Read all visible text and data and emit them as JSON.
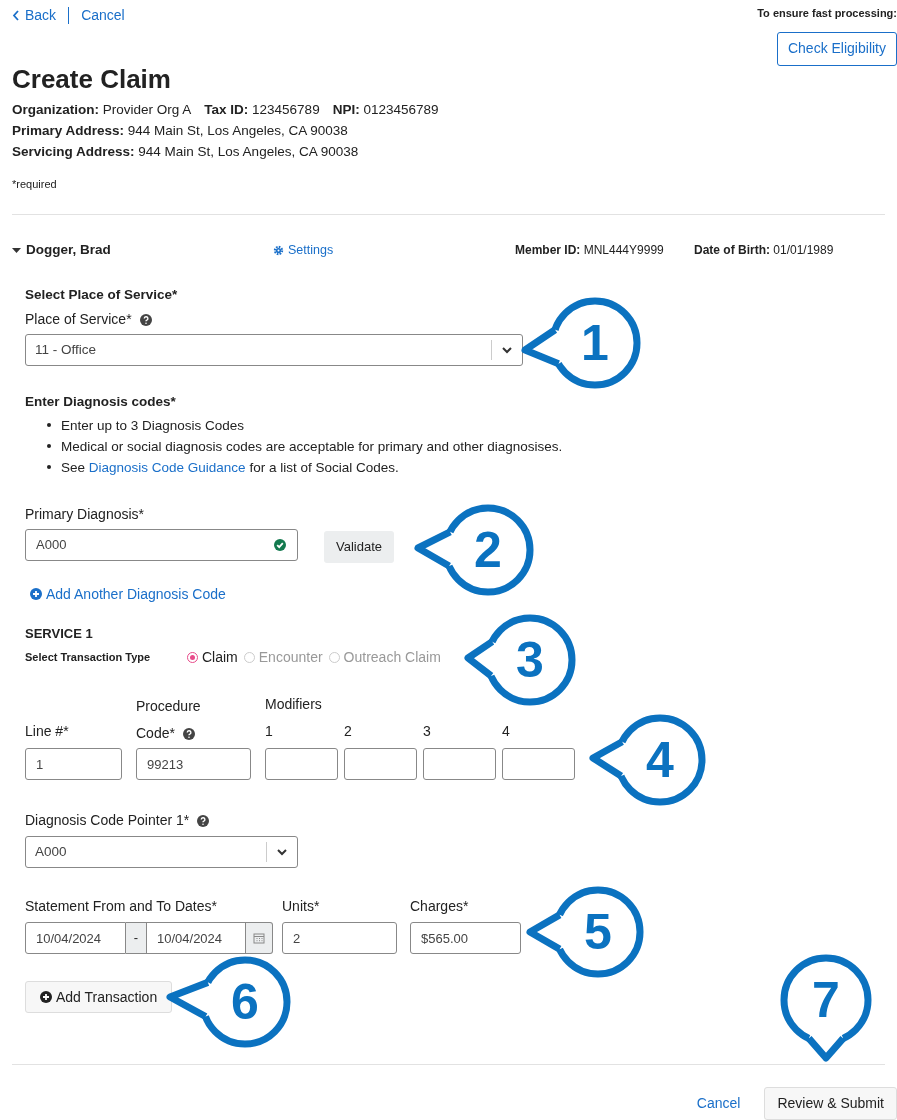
{
  "nav": {
    "back": "Back",
    "cancel": "Cancel"
  },
  "eligibility": {
    "hint": "To ensure fast processing:",
    "button": "Check Eligibility"
  },
  "title": "Create Claim",
  "provider_info": [
    [
      "**Organization:** Provider Org A",
      "**Tax ID:** 123456789",
      "**NPI:** 0123456789"
    ],
    [
      "**Primary Address:** 944 Main St, Los Angeles, CA 90038"
    ],
    [
      "**Servicing Address:** 944 Main St, Los Angeles, CA 90038"
    ]
  ],
  "required_note": "*required",
  "patient": {
    "name": "Dogger, Brad",
    "expanded": true,
    "settings": "Settings",
    "member_id": "**Member ID:** MNL444Y9999",
    "dob": "**Date of Birth:** 01/01/1989"
  },
  "place_of_service": {
    "heading": "Select Place of Service*",
    "label": "Place of Service*",
    "value": "11 - Office"
  },
  "diagnosis_intro": {
    "heading": "Enter Diagnosis codes*",
    "bullets": [
      {
        "text": "Enter up to 3 Diagnosis Codes"
      },
      {
        "text": "Medical or social diagnosis codes are acceptable for primary and other diagnosises."
      },
      {
        "text": "See ",
        "link": "Diagnosis Code Guidance",
        "after": " for a list of Social Codes."
      }
    ]
  },
  "primary_diagnosis": {
    "label": "Primary Diagnosis*",
    "value": "A000",
    "valid": true,
    "button": "Validate"
  },
  "add_diagnosis": "Add Another Diagnosis Code",
  "service": {
    "heading": "SERVICE 1",
    "transaction_label": "Select Transaction Type",
    "transaction_types": [
      {
        "label": "Claim",
        "selected": true,
        "disabled": false
      },
      {
        "label": "Encounter",
        "selected": false,
        "disabled": true
      },
      {
        "label": "Outreach Claim",
        "selected": false,
        "disabled": true
      }
    ],
    "line": {
      "label": "Line #*",
      "value": "1"
    },
    "procedure": {
      "label_top": "Procedure",
      "label": "Code*",
      "value": "99213"
    },
    "modifiers": {
      "heading": "Modifiers",
      "fields": [
        {
          "label": "1"
        },
        {
          "label": "2"
        },
        {
          "label": "3"
        },
        {
          "label": "4"
        }
      ]
    },
    "pointer": {
      "label": "Diagnosis Code Pointer 1*",
      "value": "A000"
    },
    "dates": {
      "label": "Statement From and To Dates*",
      "from": "10/04/2024",
      "separator": "-",
      "to": "10/04/2024"
    },
    "units": {
      "label": "Units*",
      "value": "2"
    },
    "charges": {
      "label": "Charges*",
      "value": "$565.00"
    }
  },
  "add_transaction": "Add Transaction",
  "footer": {
    "cancel": "Cancel",
    "submit": "Review & Submit"
  },
  "callouts": [
    {
      "number": "1"
    },
    {
      "number": "2"
    },
    {
      "number": "3"
    },
    {
      "number": "4"
    },
    {
      "number": "5"
    },
    {
      "number": "6"
    },
    {
      "number": "7"
    }
  ]
}
